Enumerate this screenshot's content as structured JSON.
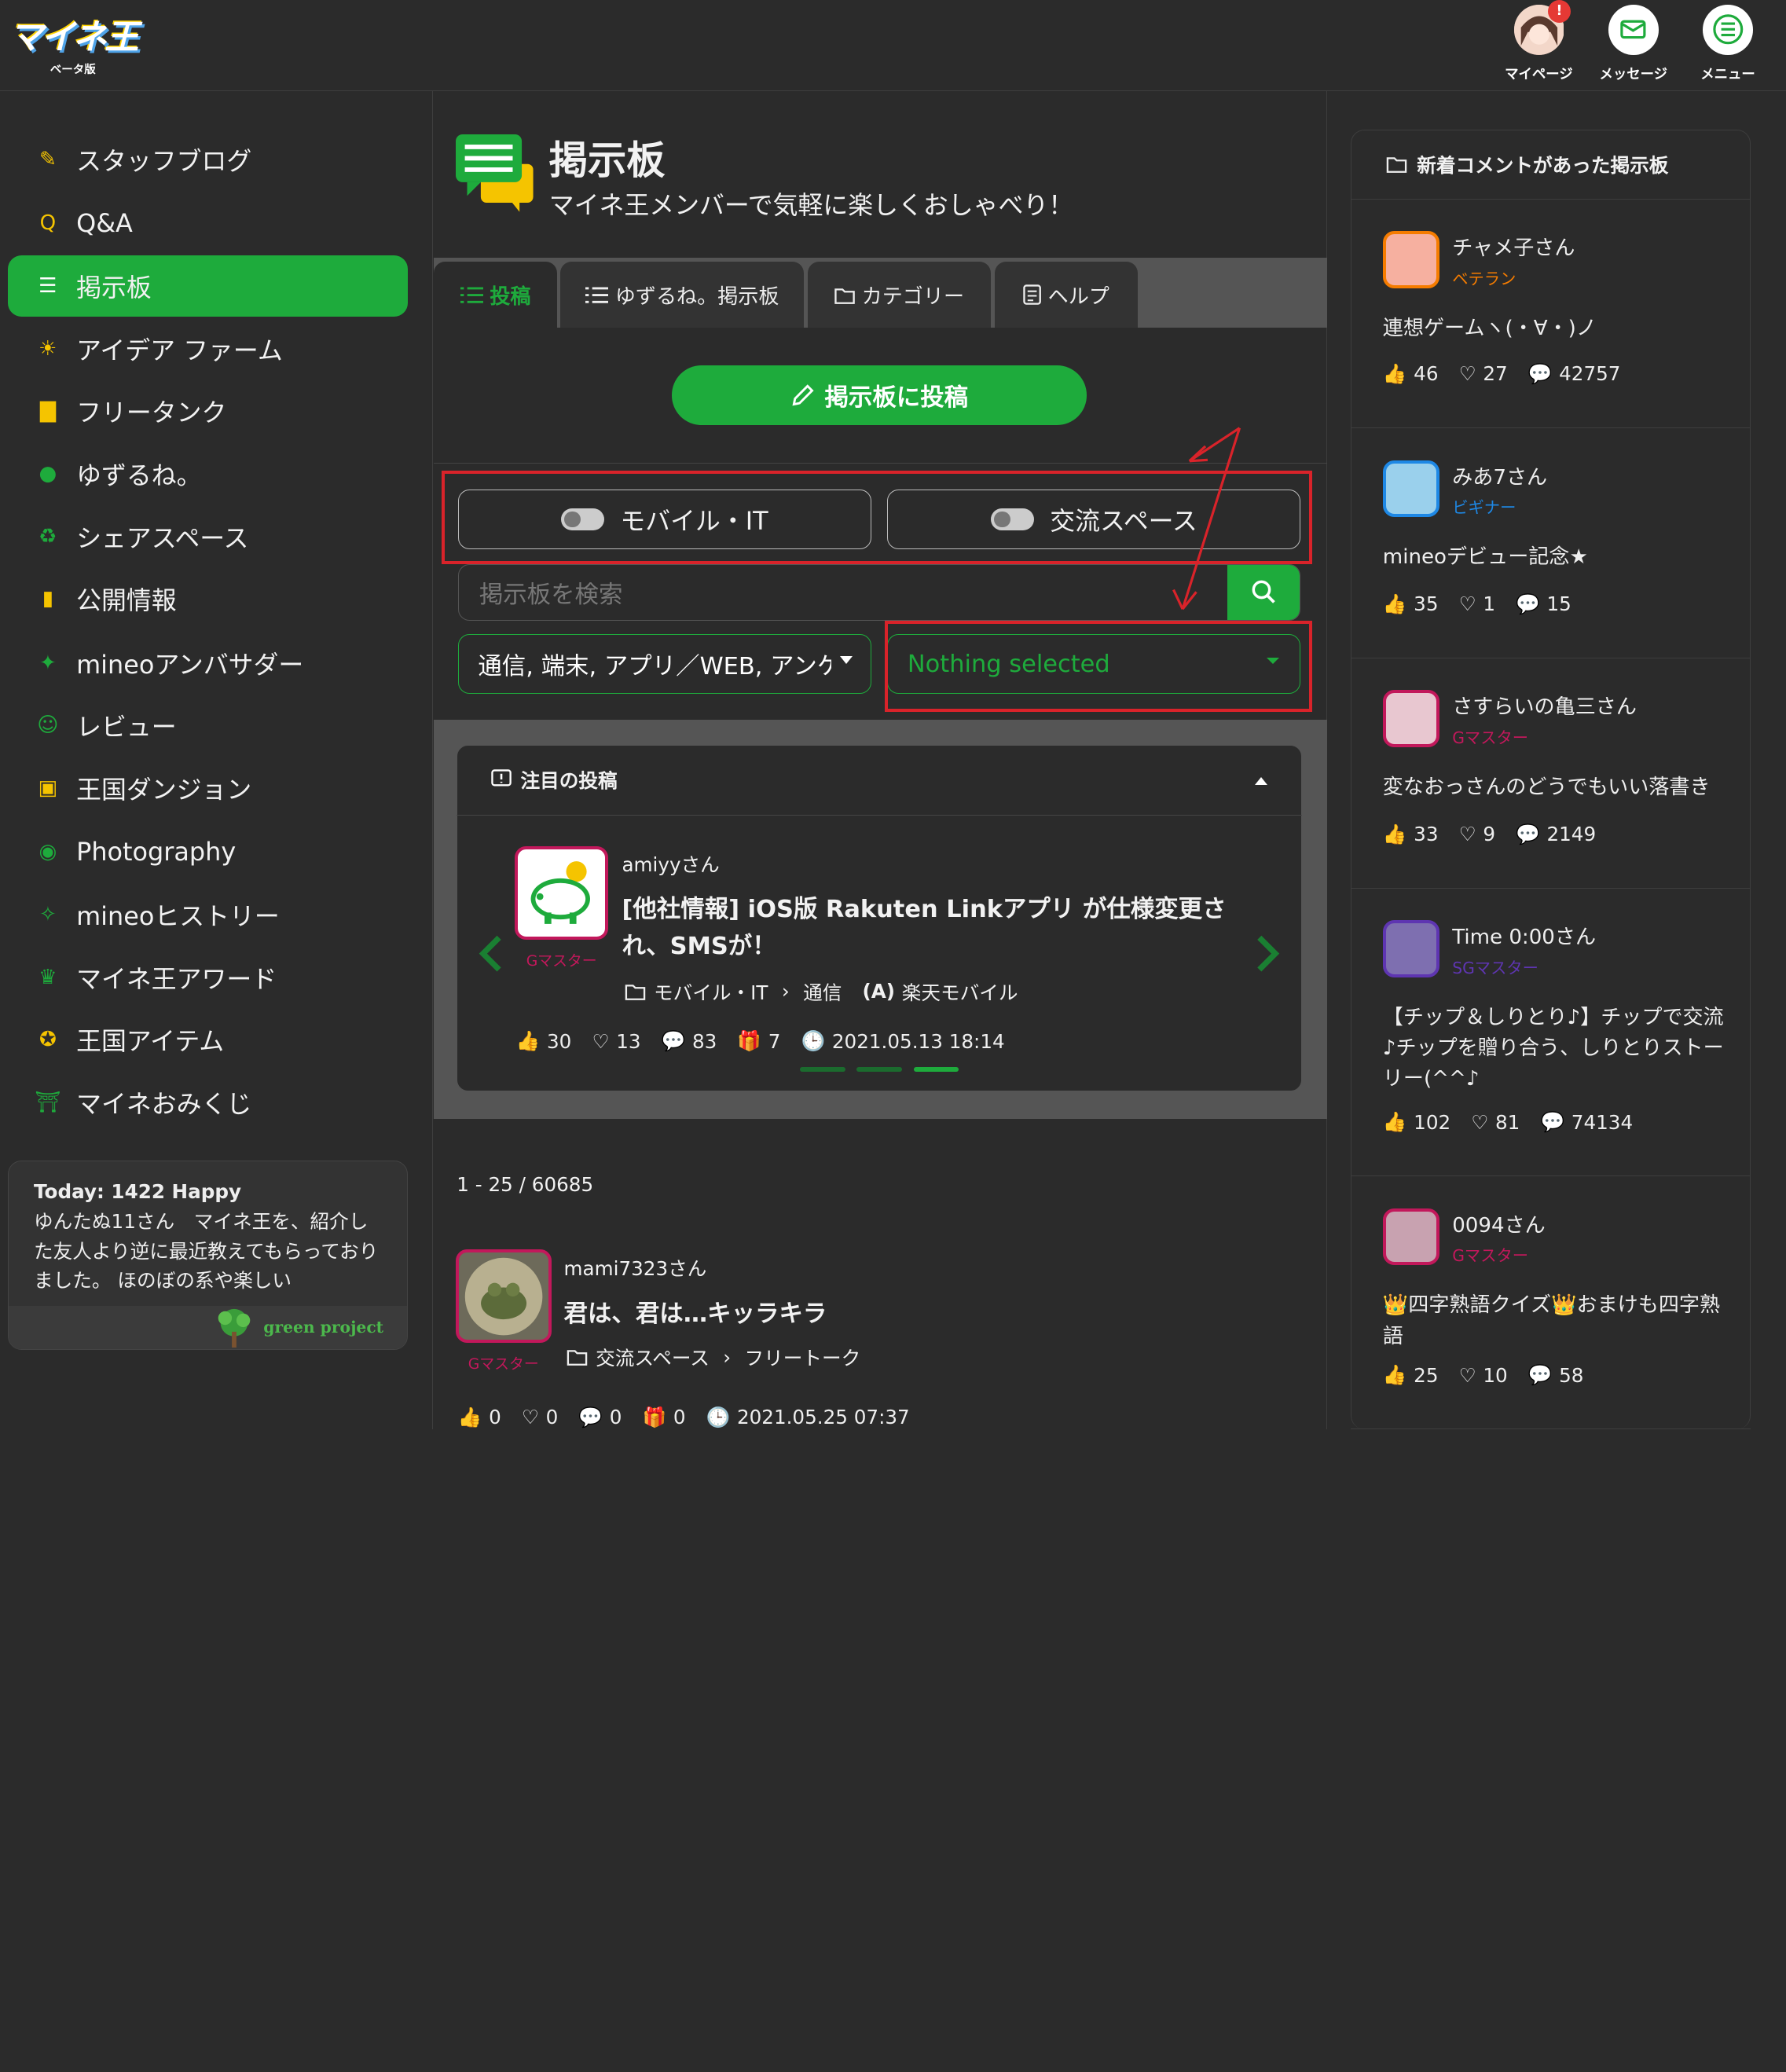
{
  "header": {
    "logo": "マイネ王",
    "logo_sub": "ベータ版",
    "mypage": "マイページ",
    "message": "メッセージ",
    "menu": "メニュー",
    "badge": "!"
  },
  "sidebar": {
    "items": [
      {
        "label": "スタッフブログ",
        "icon": "staff-blog-icon"
      },
      {
        "label": "Q&A",
        "icon": "qa-icon"
      },
      {
        "label": "掲示板",
        "icon": "board-icon"
      },
      {
        "label": "アイデア ファーム",
        "icon": "idea-icon"
      },
      {
        "label": "フリータンク",
        "icon": "tank-icon"
      },
      {
        "label": "ゆずるね。",
        "icon": "yuzurune-icon"
      },
      {
        "label": "シェアスペース",
        "icon": "share-icon"
      },
      {
        "label": "公開情報",
        "icon": "chart-icon"
      },
      {
        "label": "mineoアンバサダー",
        "icon": "ambassador-icon"
      },
      {
        "label": "レビュー",
        "icon": "review-icon"
      },
      {
        "label": "王国ダンジョン",
        "icon": "treasure-icon"
      },
      {
        "label": "Photography",
        "icon": "camera-icon"
      },
      {
        "label": "mineoヒストリー",
        "icon": "history-icon"
      },
      {
        "label": "マイネ王アワード",
        "icon": "trophy-icon"
      },
      {
        "label": "王国アイテム",
        "icon": "item-icon"
      },
      {
        "label": "マイネおみくじ",
        "icon": "torii-icon"
      }
    ],
    "today_title": "Today: 1422 Happy",
    "today_text": "ゆんたぬ11さん　マイネ王を、紹介した友人より逆に最近教えてもらっておりました。 ほのぼの系や楽しい",
    "green_project": "green project"
  },
  "main": {
    "title": "掲示板",
    "subtitle": "マイネ王メンバーで気軽に楽しくおしゃべり！",
    "tabs": [
      "投稿",
      "ゆずるね。掲示板",
      "カテゴリー",
      "ヘルプ"
    ],
    "post_button": "掲示板に投稿",
    "toggles": [
      "モバイル・IT",
      "交流スペース"
    ],
    "search_placeholder": "掲示板を検索",
    "select1": "通信, 端末, アプリ／WEB, アンケ",
    "select2": "Nothing selected",
    "featured_title": "注目の投稿",
    "featured": {
      "user": "amiyyさん",
      "rank": "Gマスター",
      "title": "[他社情報] iOS版 Rakuten Linkアプリ が仕様変更され、SMSが！",
      "cat1": "モバイル・IT",
      "cat2": "通信",
      "cat3": "楽天モバイル",
      "likes": "30",
      "hearts": "13",
      "comments": "83",
      "gifts": "7",
      "date": "2021.05.13 18:14"
    },
    "count": "1 - 25 / 60685",
    "post": {
      "user": "mami7323さん",
      "rank": "Gマスター",
      "title": "君は、君は…キッラキラ",
      "cat1": "交流スペース",
      "cat2": "フリートーク",
      "likes": "0",
      "hearts": "0",
      "comments": "0",
      "gifts": "0",
      "date": "2021.05.25 07:37"
    }
  },
  "right": {
    "title": "新着コメントがあった掲示板",
    "items": [
      {
        "user": "チャメ子さん",
        "rank": "ベテラン",
        "rank_color": "#f57c00",
        "title": "連想ゲームヽ(・∀・)ノ",
        "likes": "46",
        "hearts": "27",
        "comments": "42757"
      },
      {
        "user": "みあ7さん",
        "rank": "ビギナー",
        "rank_color": "#1e88e5",
        "title": "mineoデビュー記念★",
        "likes": "35",
        "hearts": "1",
        "comments": "15"
      },
      {
        "user": "さすらいの亀三さん",
        "rank": "Gマスター",
        "rank_color": "#c2185b",
        "title": "変なおっさんのどうでもいい落書き",
        "likes": "33",
        "hearts": "9",
        "comments": "2149"
      },
      {
        "user": "Time 0:00さん",
        "rank": "SGマスター",
        "rank_color": "#5e35b1",
        "title": "【チップ＆しりとり♪】チップで交流♪チップを贈り合う、しりとりストーリー(^^♪",
        "likes": "102",
        "hearts": "81",
        "comments": "74134"
      },
      {
        "user": "0094さん",
        "rank": "Gマスター",
        "rank_color": "#c2185b",
        "title": "👑四字熟語クイズ👑おまけも四字熟語",
        "likes": "25",
        "hearts": "10",
        "comments": "58"
      }
    ]
  }
}
